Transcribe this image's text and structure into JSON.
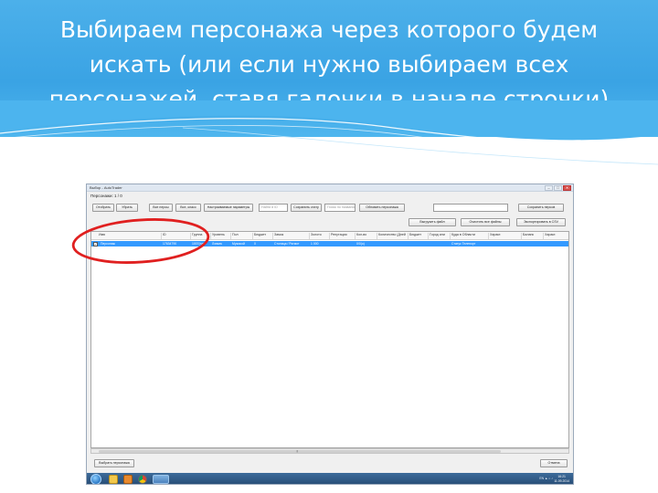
{
  "slide": {
    "title": "Выбираем персонажа через которого будем искать (или если нужно выбираем всех персонажей, ставя галочки в начале строчки)"
  },
  "window": {
    "title": "Выбор - AutoTrader",
    "count_label": "Персонажи: 1 / 0",
    "controls": [
      "–",
      "□",
      "✕"
    ]
  },
  "toolbar": {
    "buttons_row1": [
      {
        "name": "select-all",
        "label": "Отобрать"
      },
      {
        "name": "clear",
        "label": "Убрать"
      },
      {
        "name": "import-button",
        "label": "Все персы"
      },
      {
        "name": "all-add-button",
        "label": "Все, класс"
      },
      {
        "name": "settings-button",
        "label": "Настраиваемые параметры"
      },
      {
        "name": "save-button",
        "label": "Сохранить стату"
      },
      {
        "name": "update-server-button",
        "label": "Обновить персонажа"
      },
      {
        "name": "save-pers-button",
        "label": "Сохранить персов"
      }
    ],
    "input_1_placeholder": "Найти в ID",
    "input_2_placeholder": "Поиск по названию",
    "search_value": "",
    "buttons_row2": [
      {
        "name": "find-file-button",
        "label": "Выгрузить файл"
      },
      {
        "name": "clear-file-button",
        "label": "Очистить все файлы"
      },
      {
        "name": "export-csv-button",
        "label": "Экспортировать в CSV"
      }
    ]
  },
  "grid": {
    "columns": [
      "Имя",
      "ID",
      "Группа",
      "Уровень",
      "Пол",
      "Бюджет",
      "Замок",
      "Золото",
      "Репутация",
      "Кол-во",
      "Количество (Дней)",
      "Бюджет",
      "Город или",
      "Куда в Области",
      "Характ.",
      "Баланс",
      "Характ."
    ],
    "rows": [
      {
        "checked": true,
        "cells": [
          "Персонаж",
          "17634790",
          "1007(пл",
          "Ловкач",
          "Мужской",
          "0",
          "Столица / Ригмот",
          "1 000",
          "",
          "0/0(о)",
          "",
          "",
          "",
          "Статус Телепорт",
          "",
          "",
          ""
        ]
      }
    ]
  },
  "footer": {
    "select_button": "Выбрать персонажа",
    "cancel_button": "Отмена"
  },
  "taskbar": {
    "tray_text": "EN  ▲  ⌂  ♪",
    "clock_time": "16:21",
    "clock_date": "11.09.2014"
  },
  "colors": {
    "header_blue": "#3aa3e4",
    "selection_blue": "#3399ff",
    "annotation_red": "#e02020"
  }
}
